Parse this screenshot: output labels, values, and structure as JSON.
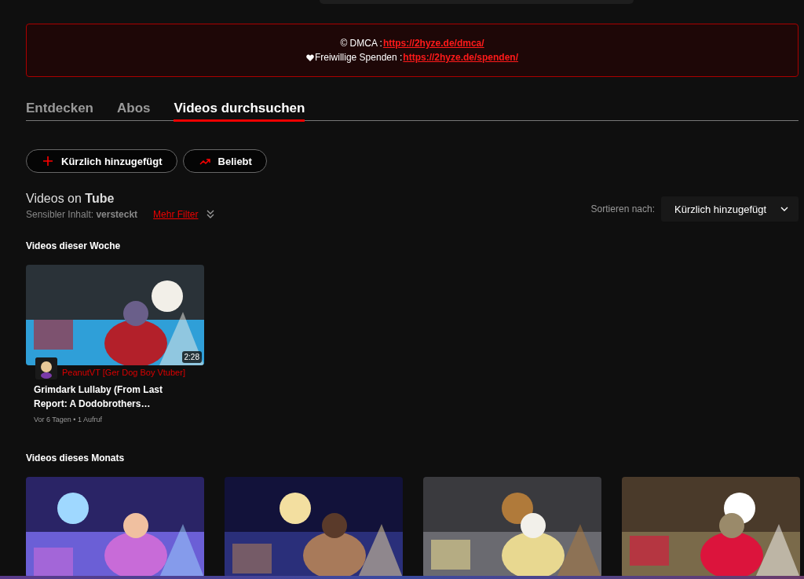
{
  "notice": {
    "lines": [
      {
        "kind": "copyright",
        "label": "© DMCA : ",
        "link": "https://2hyze.de/dmca/"
      },
      {
        "kind": "heart",
        "label": "Freiwillige Spenden : ",
        "link": "https://2hyze.de/spenden/"
      }
    ]
  },
  "tabs": [
    {
      "label": "Entdecken",
      "selected": false
    },
    {
      "label": "Abos",
      "selected": false
    },
    {
      "label": "Videos durchsuchen",
      "selected": true
    }
  ],
  "filter_buttons": [
    {
      "label": "Kürzlich hinzugefügt",
      "kind": "plus"
    },
    {
      "label": "Beliebt",
      "kind": "trending"
    }
  ],
  "heading": "Videos on **Tube**",
  "filters": {
    "sensitive": "Sensibler Inhalt: **versteckt**",
    "more_link": "Mehr Filter"
  },
  "sort": {
    "label": "Sortieren nach:",
    "value": "Kürzlich hinzugefügt"
  },
  "sections": [
    {
      "title": "Videos dieser Woche",
      "videos": [
        {
          "kind": "full",
          "duration": "2:28",
          "channel": "PeanutVT [Ger Dog Boy Vtuber]",
          "title": "Grimdark Lullaby (From Last Report: A Dodobrothers…",
          "meta": "Vor 6 Tagen • 1 Aufruf"
        }
      ]
    },
    {
      "title": "Videos dieses Monats"
    }
  ]
}
